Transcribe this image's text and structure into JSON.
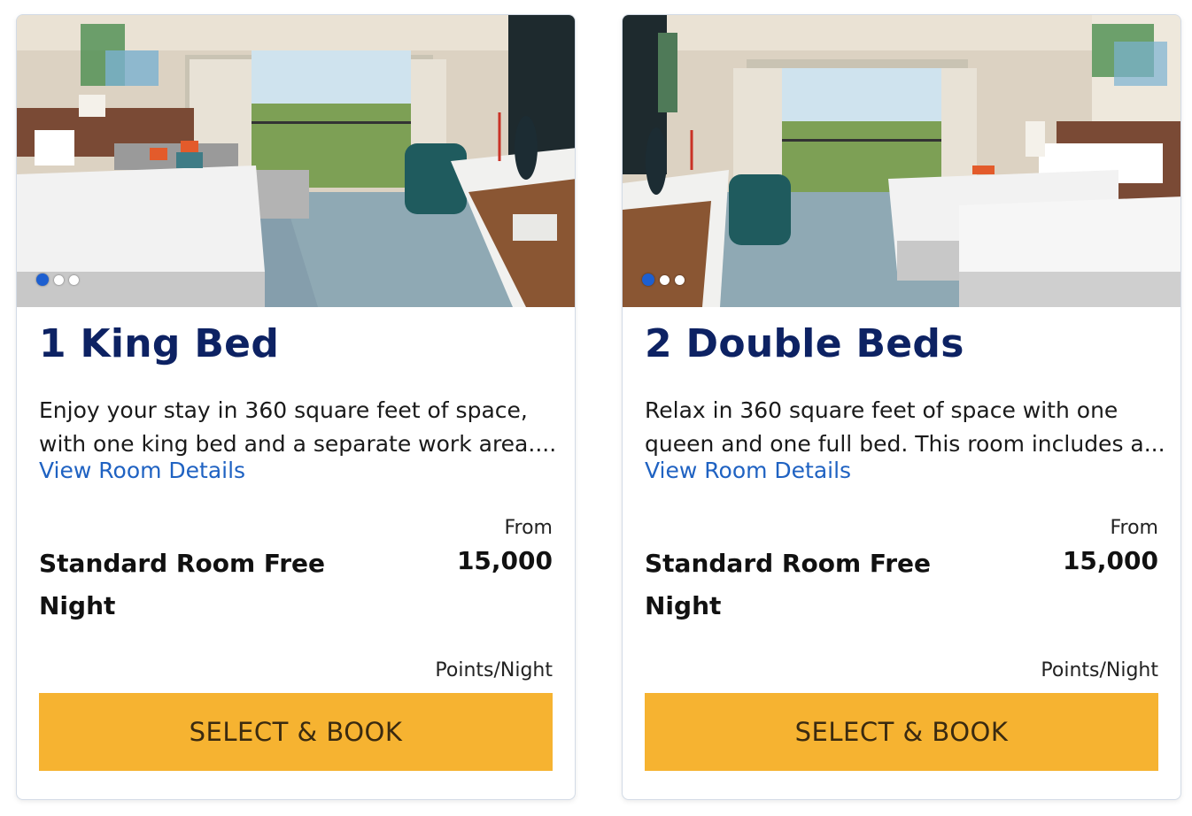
{
  "rooms": [
    {
      "title": "1 King Bed",
      "desc_line1": "Enjoy your stay in 360 square feet of space,",
      "desc_line2": "with one king bed and a separate work area....",
      "link": "View Room Details",
      "from_label": "From",
      "rate_line1": "Standard Room Free",
      "rate_line2": "Night",
      "points": "15,000",
      "points_unit": "Points/Night",
      "button": "SELECT & BOOK",
      "carousel": {
        "total": 3,
        "active": 1
      }
    },
    {
      "title": "2 Double Beds",
      "desc_line1": "Relax in 360 square feet of space with one",
      "desc_line2": "queen and one full bed. This room includes a...",
      "link": "View Room Details",
      "from_label": "From",
      "rate_line1": "Standard Room Free",
      "rate_line2": "Night",
      "points": "15,000",
      "points_unit": "Points/Night",
      "button": "SELECT & BOOK",
      "carousel": {
        "total": 3,
        "active": 1
      }
    }
  ],
  "colors": {
    "title": "#0d2263",
    "link": "#1f62c2",
    "button": "#f6b331",
    "dot_active": "#1d5fd0",
    "border": "#d3dbe6"
  }
}
